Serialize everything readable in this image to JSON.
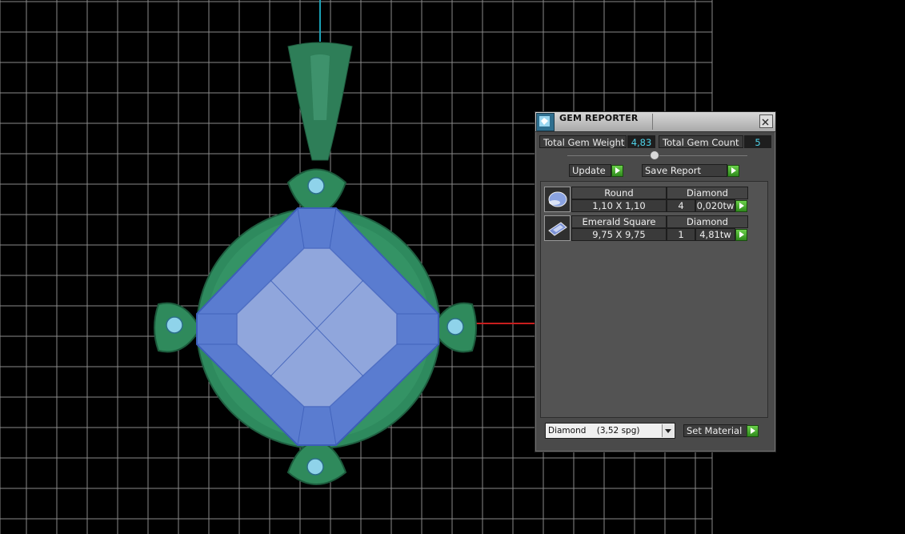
{
  "panel": {
    "title": "GEM REPORTER",
    "total_weight_label": "Total Gem Weight",
    "total_weight_value": "4,83",
    "total_count_label": "Total Gem Count",
    "total_count_value": "5",
    "update_label": "Update",
    "save_report_label": "Save Report",
    "gems": [
      {
        "shape": "Round",
        "material": "Diamond",
        "size": "1,10 X 1,10",
        "count": "4",
        "weight": "0,020tw"
      },
      {
        "shape": "Emerald Square",
        "material": "Diamond",
        "size": "9,75 X 9,75",
        "count": "1",
        "weight": "4,81tw"
      }
    ],
    "material_select": "Diamond    (3,52 spg)",
    "set_material_label": "Set Material"
  },
  "colors": {
    "background": "#000000",
    "grid": "#8a8a8a",
    "pendant_green": "#2e8a5e",
    "gem_blue": "#7d97d8",
    "axis_red": "#c81e1e",
    "axis_cyan": "#1aa0b4",
    "value_cyan": "#4fd2e8",
    "go_green": "#3fa82a"
  },
  "icons": {
    "app": "gem-reporter-app-icon",
    "close": "close-icon",
    "go": "play-arrow-icon",
    "round_gem": "round-gem-icon",
    "square_gem": "emerald-square-gem-icon",
    "dropdown": "chevron-down-icon"
  }
}
